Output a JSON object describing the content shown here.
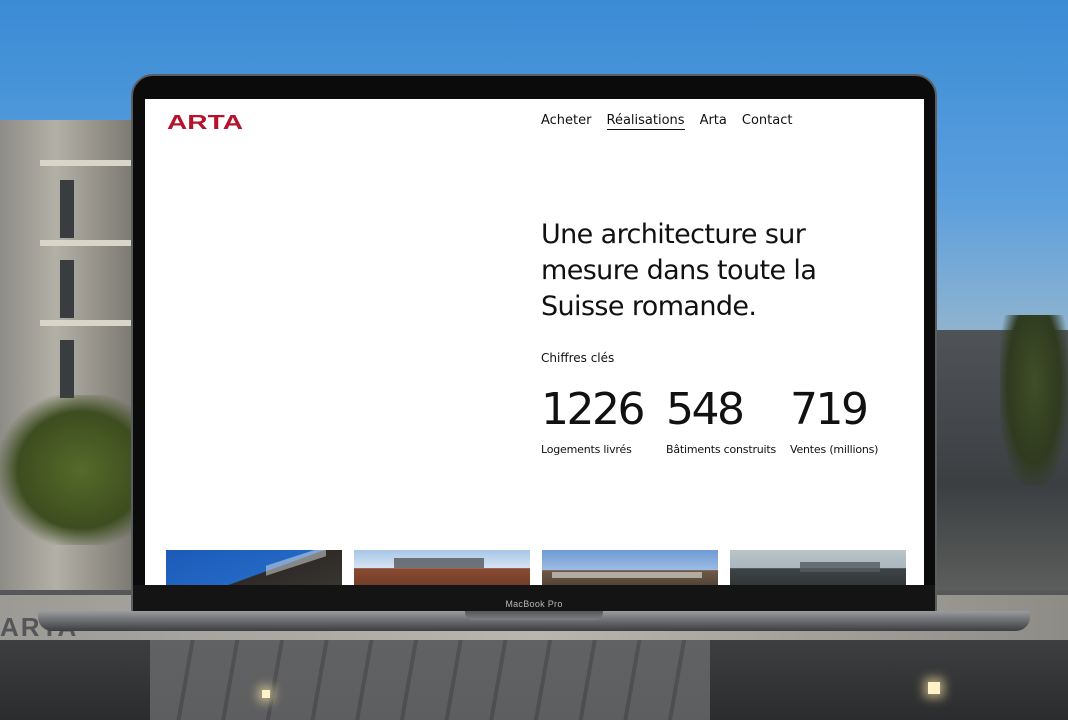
{
  "background": {
    "wall_text": "ARTA"
  },
  "device": {
    "model_label": "MacBook Pro"
  },
  "website": {
    "brand": "ARTA",
    "brand_color": "#b5122b",
    "nav": [
      {
        "label": "Acheter",
        "active": false
      },
      {
        "label": "Réalisations",
        "active": true
      },
      {
        "label": "Arta",
        "active": false
      },
      {
        "label": "Contact",
        "active": false
      }
    ],
    "headline": "Une architecture sur mesure dans toute la Suisse romande.",
    "stats_title": "Chiffres clés",
    "stats": [
      {
        "value": "1226",
        "label": "Logements livrés"
      },
      {
        "value": "548",
        "label": "Bâtiments construits"
      },
      {
        "value": "719",
        "label": "Ventes (millions)"
      }
    ],
    "thumbnails": [
      {
        "icon": "project-photo-1"
      },
      {
        "icon": "project-photo-2"
      },
      {
        "icon": "project-photo-3"
      },
      {
        "icon": "project-photo-4"
      }
    ]
  }
}
